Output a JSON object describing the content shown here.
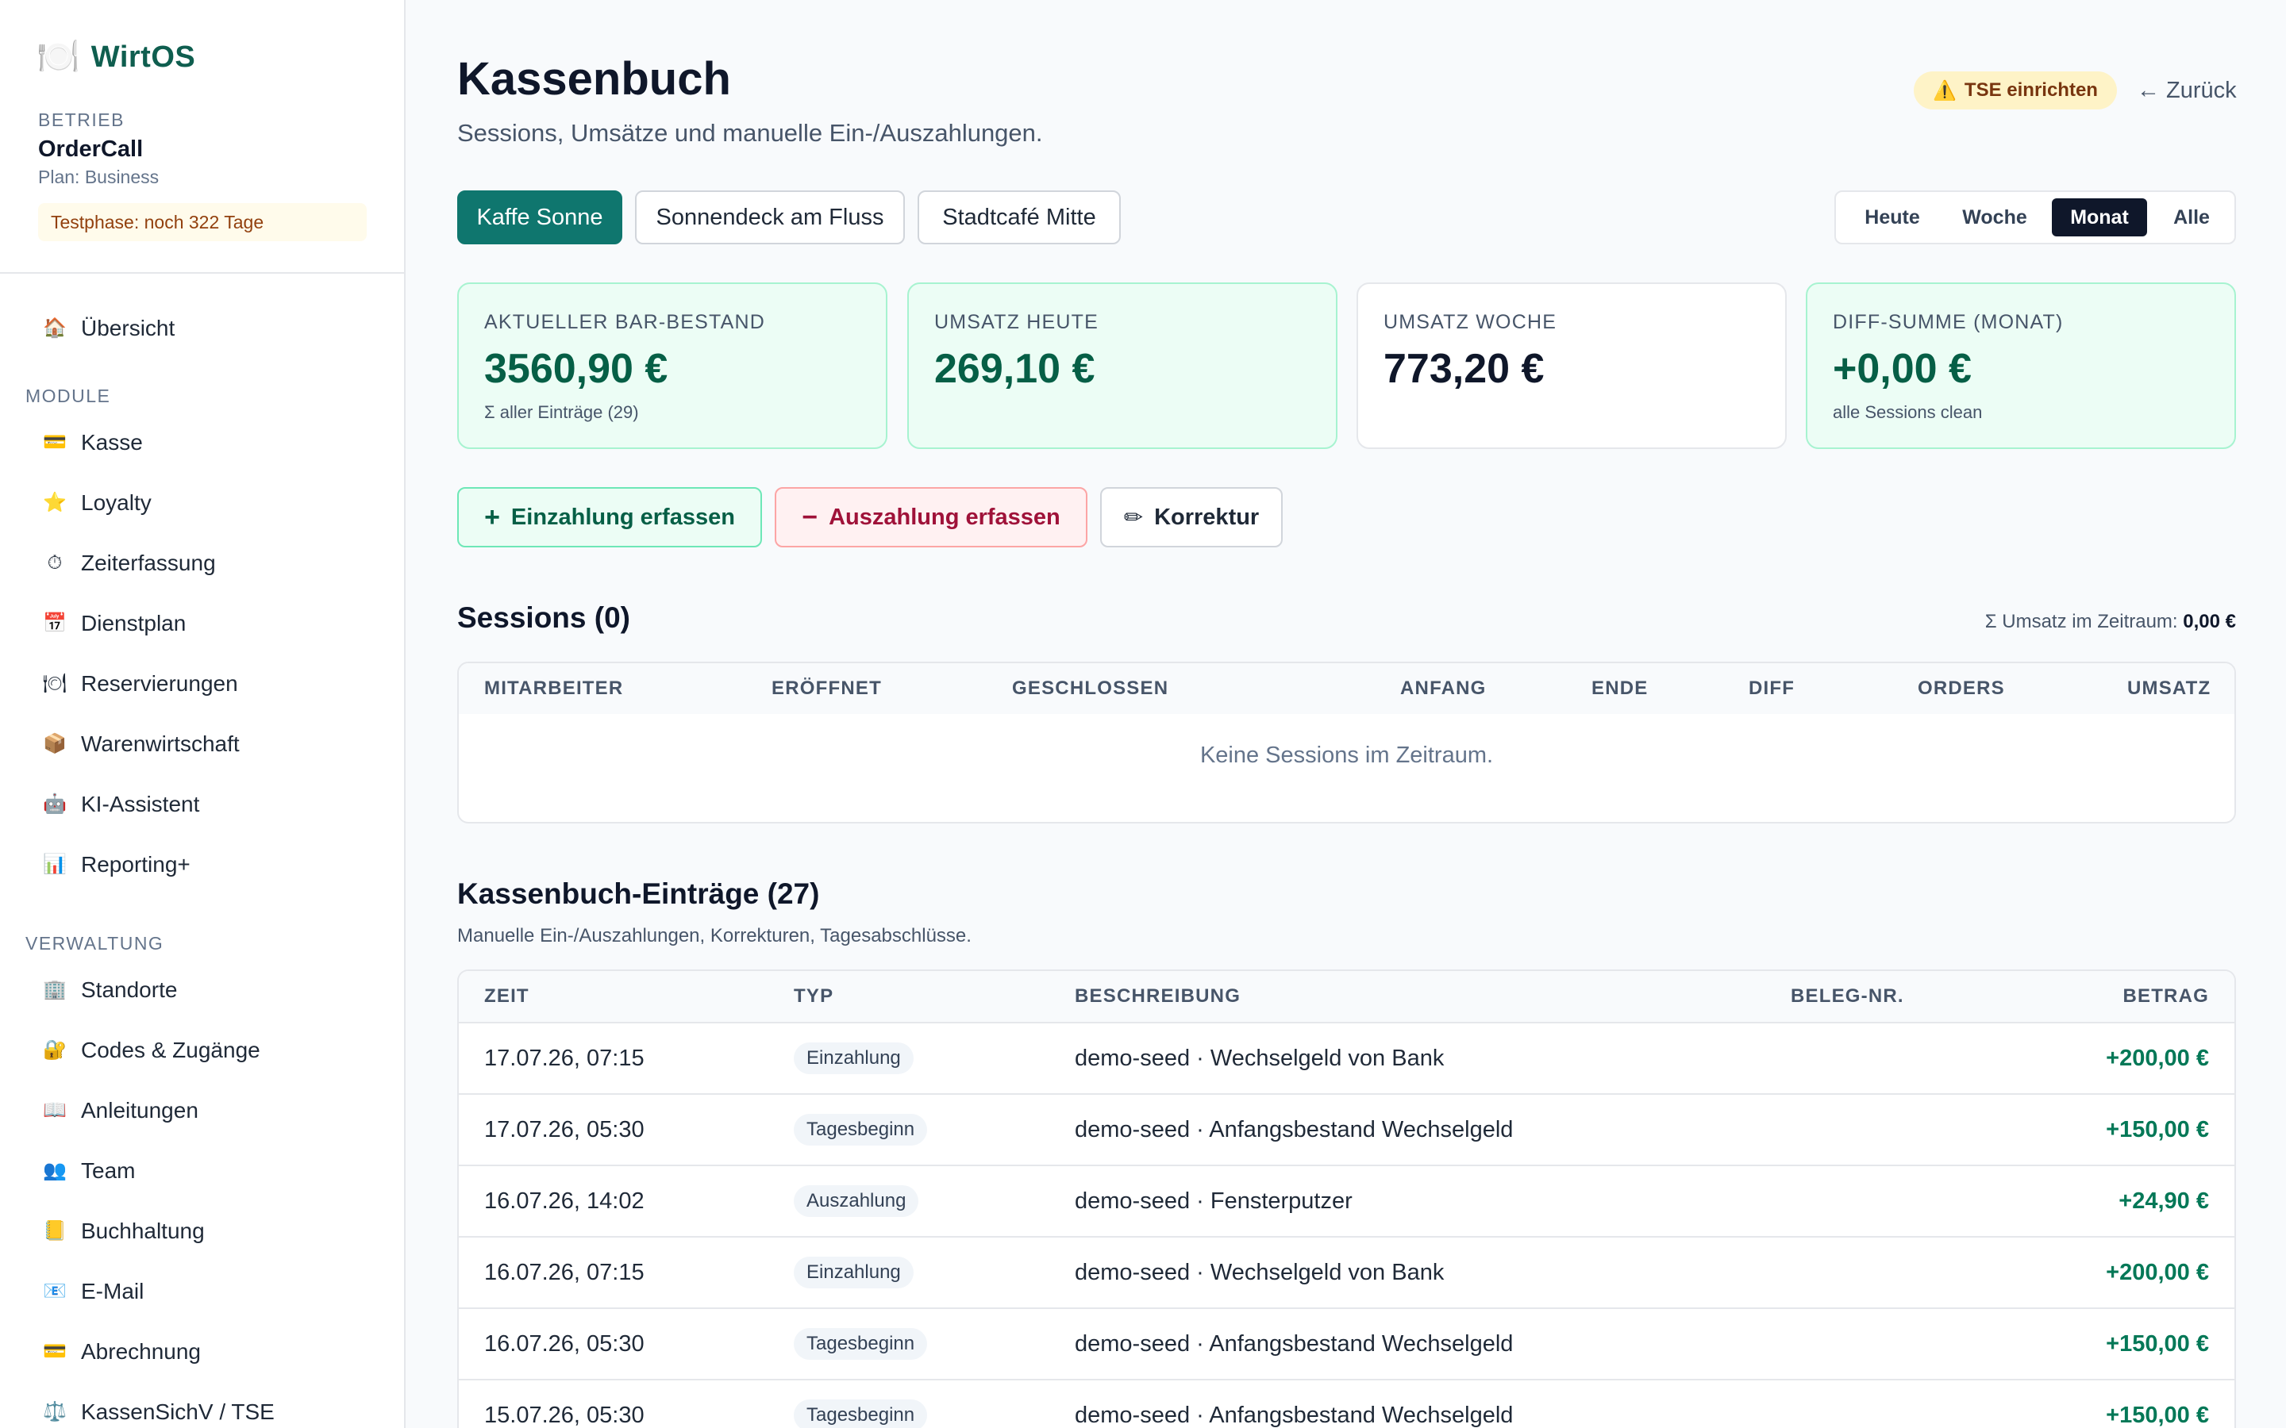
{
  "sidebar": {
    "brand": {
      "icon": "plate-icon",
      "name": "WirtOS"
    },
    "org_label": "BETRIEB",
    "org_name": "OrderCall",
    "plan": "Plan: Business",
    "trial": "Testphase: noch 322 Tage",
    "overview": {
      "icon": "house-icon",
      "label": "Übersicht"
    },
    "modules_label": "MODULE",
    "modules": [
      {
        "icon": "card-icon",
        "label": "Kasse"
      },
      {
        "icon": "star-icon",
        "label": "Loyalty"
      },
      {
        "icon": "stopwatch-icon",
        "label": "Zeiterfassung"
      },
      {
        "icon": "calendar-icon",
        "label": "Dienstplan"
      },
      {
        "icon": "plate-icon",
        "label": "Reservierungen"
      },
      {
        "icon": "box-icon",
        "label": "Warenwirtschaft"
      },
      {
        "icon": "robot-icon",
        "label": "KI-Assistent"
      },
      {
        "icon": "chart-icon",
        "label": "Reporting+"
      }
    ],
    "admin_label": "VERWALTUNG",
    "admin": [
      {
        "icon": "building-icon",
        "label": "Standorte"
      },
      {
        "icon": "lock-icon",
        "label": "Codes & Zugänge"
      },
      {
        "icon": "book-icon",
        "label": "Anleitungen"
      },
      {
        "icon": "team-icon",
        "label": "Team"
      },
      {
        "icon": "ledger-icon",
        "label": "Buchhaltung"
      },
      {
        "icon": "mail-icon",
        "label": "E-Mail"
      },
      {
        "icon": "card-icon",
        "label": "Abrechnung"
      },
      {
        "icon": "scales-icon",
        "label": "KassenSichV / TSE"
      }
    ]
  },
  "header": {
    "title": "Kassenbuch",
    "subtitle": "Sessions, Umsätze und manuelle Ein-/Auszahlungen.",
    "tse_badge": "TSE einrichten",
    "back": "Zurück"
  },
  "locations": [
    "Kaffe Sonne",
    "Sonnendeck am Fluss",
    "Stadtcafé Mitte"
  ],
  "ranges": [
    "Heute",
    "Woche",
    "Monat",
    "Alle"
  ],
  "selected_range": "Monat",
  "cards": [
    {
      "label": "AKTUELLER BAR-BESTAND",
      "value": "3560,90 €",
      "sub": "Σ aller Einträge (29)"
    },
    {
      "label": "UMSATZ HEUTE",
      "value": "269,10 €",
      "sub": ""
    },
    {
      "label": "UMSATZ WOCHE",
      "value": "773,20 €",
      "sub": ""
    },
    {
      "label": "DIFF-SUMME (MONAT)",
      "value": "+0,00 €",
      "sub": "alle Sessions clean"
    }
  ],
  "actions": {
    "deposit": "Einzahlung erfassen",
    "withdrawal": "Auszahlung erfassen",
    "correction": "Korrektur"
  },
  "sessions": {
    "title": "Sessions (0)",
    "sum_label": "Σ Umsatz im Zeitraum:",
    "sum_value": "0,00 €",
    "columns": [
      "MITARBEITER",
      "ERÖFFNET",
      "GESCHLOSSEN",
      "ANFANG",
      "ENDE",
      "DIFF",
      "ORDERS",
      "UMSATZ"
    ],
    "empty": "Keine Sessions im Zeitraum."
  },
  "entries": {
    "title": "Kassenbuch-Einträge (27)",
    "subtitle": "Manuelle Ein-/Auszahlungen, Korrekturen, Tagesabschlüsse.",
    "columns": [
      "ZEIT",
      "TYP",
      "BESCHREIBUNG",
      "BELEG-NR.",
      "BETRAG"
    ],
    "rows": [
      {
        "time": "17.07.26, 07:15",
        "type": "Einzahlung",
        "desc": "demo-seed · Wechselgeld von Bank",
        "receipt": "",
        "amount": "+200,00 €"
      },
      {
        "time": "17.07.26, 05:30",
        "type": "Tagesbeginn",
        "desc": "demo-seed · Anfangsbestand Wechselgeld",
        "receipt": "",
        "amount": "+150,00 €"
      },
      {
        "time": "16.07.26, 14:02",
        "type": "Auszahlung",
        "desc": "demo-seed · Fensterputzer",
        "receipt": "",
        "amount": "+24,90 €"
      },
      {
        "time": "16.07.26, 07:15",
        "type": "Einzahlung",
        "desc": "demo-seed · Wechselgeld von Bank",
        "receipt": "",
        "amount": "+200,00 €"
      },
      {
        "time": "16.07.26, 05:30",
        "type": "Tagesbeginn",
        "desc": "demo-seed · Anfangsbestand Wechselgeld",
        "receipt": "",
        "amount": "+150,00 €"
      },
      {
        "time": "15.07.26, 05:30",
        "type": "Tagesbeginn",
        "desc": "demo-seed · Anfangsbestand Wechselgeld",
        "receipt": "",
        "amount": "+150,00 €"
      }
    ]
  },
  "colors": {
    "brand": "#0f5e4f",
    "accent": "#0f766e",
    "positive": "#047857",
    "negative": "#9f1239",
    "warning_bg": "#fef3c7"
  }
}
